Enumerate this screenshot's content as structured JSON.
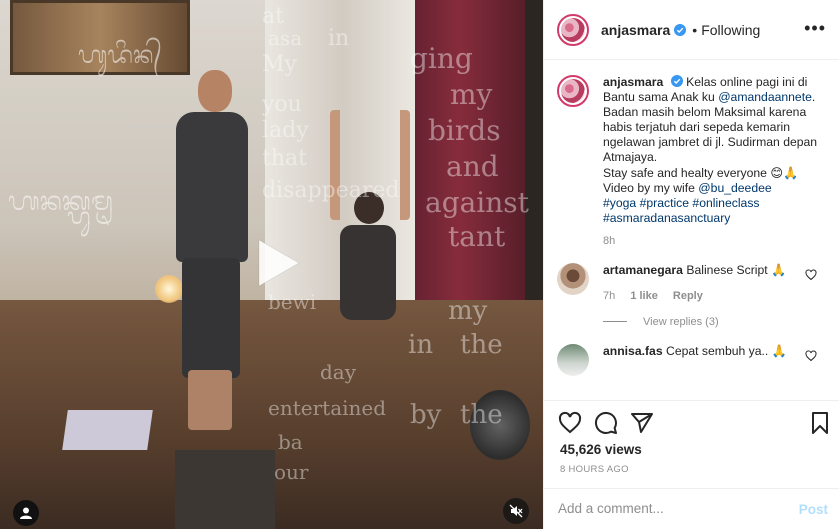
{
  "header": {
    "username": "anjasmara",
    "separator": "•",
    "follow_status": "Following",
    "more_label": "•••"
  },
  "caption": {
    "username": "anjasmara",
    "text_1": "Kelas online pagi ini di Bantu sama Anak ku ",
    "mention_1": "@amandaannete",
    "text_2": ". Badan masih belom Maksimal karena habis terjatuh dari sepeda kemarin ngelawan jambret di jl. Sudirman depan Atmajaya.",
    "text_3": "Stay safe and healty everyone 😊🙏",
    "text_4": "Video by my wife ",
    "mention_2": "@bu_deedee",
    "hashtags_1": "#yoga #practice #onlineclass",
    "hashtags_2": "#asmaradanasanctuary",
    "time": "8h"
  },
  "comments": [
    {
      "username": "artamanegara",
      "text": "Balinese Script 🙏",
      "time": "7h",
      "likes": "1 like",
      "reply": "Reply"
    },
    {
      "username": "annisa.fas",
      "text": "Cepat sembuh ya.. 🙏"
    }
  ],
  "view_replies": "View replies (3)",
  "stats": {
    "views": "45,626 views",
    "time_ago": "8 HOURS AGO"
  },
  "add_comment": {
    "placeholder": "Add a comment...",
    "post_label": "Post"
  },
  "video_overlay_text": [
    "at",
    "asa",
    "in",
    "My",
    "ging",
    "you",
    "my",
    "lady",
    "birds",
    "that",
    "and",
    "disappeared",
    "against",
    "tant",
    "bewi",
    "my",
    "in",
    "the",
    "day",
    "entertained",
    "by",
    "the",
    "ba",
    "our"
  ],
  "video_overlay_script": [
    "ᬳᬸᬤᬶᬦ᭄",
    "ᬳᬦᬓ᭄ᬳᬸᬫᬺ"
  ],
  "colors": {
    "accent": "#0095f6",
    "link": "#00376b",
    "muted": "#8e8e8e",
    "verified": "#3897f0",
    "story_ring": "#d33a6a"
  },
  "icons": [
    "play-icon",
    "avatar-icon",
    "mute-icon",
    "verified-icon",
    "more-icon",
    "heart-icon",
    "comment-icon",
    "share-icon",
    "bookmark-icon"
  ]
}
